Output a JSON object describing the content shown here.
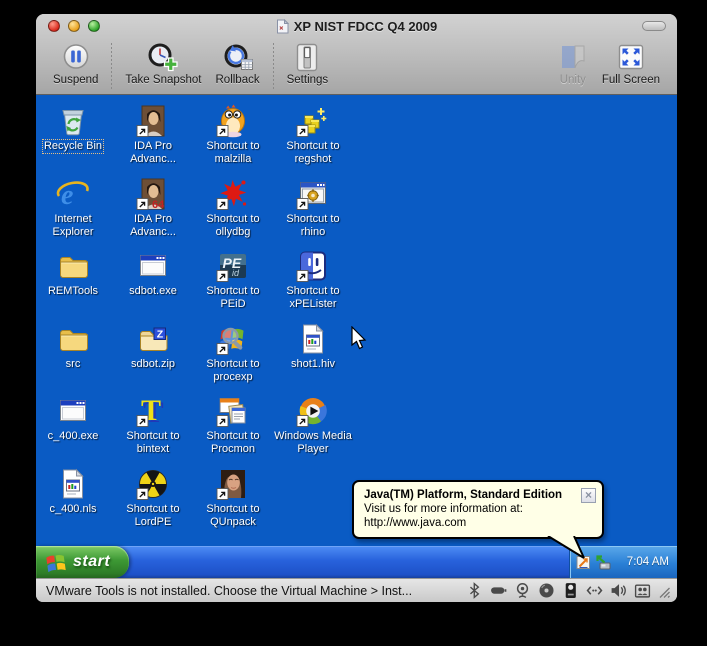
{
  "window": {
    "title": "XP NIST FDCC Q4 2009",
    "title_proxy_icon": "document-icon",
    "traffic_lights": [
      {
        "name": "close-button",
        "color": "#D92A1E"
      },
      {
        "name": "minimize-button",
        "color": "#E8A11E"
      },
      {
        "name": "zoom-button",
        "color": "#2FA42A"
      }
    ],
    "toolbar": {
      "buttons": [
        {
          "label": "Suspend",
          "icon": "suspend-icon",
          "disabled": false
        },
        {
          "label": "Take Snapshot",
          "icon": "snapshot-icon",
          "disabled": false
        },
        {
          "label": "Rollback",
          "icon": "rollback-icon",
          "disabled": false
        },
        {
          "label": "Settings",
          "icon": "settings-icon",
          "disabled": false
        }
      ],
      "right_buttons": [
        {
          "label": "Unity",
          "icon": "unity-icon",
          "disabled": true
        },
        {
          "label": "Full Screen",
          "icon": "fullscreen-icon",
          "disabled": false
        }
      ]
    }
  },
  "desktop": {
    "background_color": "#0A5BC4",
    "icons": [
      {
        "label": "Recycle Bin",
        "icon": "recycle-bin-icon",
        "shortcut": false,
        "selected": true
      },
      {
        "label": "IDA Pro Advanc...",
        "icon": "ida-pro-icon",
        "shortcut": true,
        "selected": false
      },
      {
        "label": "Shortcut to malzilla",
        "icon": "malzilla-icon",
        "shortcut": true,
        "selected": false
      },
      {
        "label": "Shortcut to regshot",
        "icon": "regshot-icon",
        "shortcut": true,
        "selected": false
      },
      {
        "label": "Internet Explorer",
        "icon": "internet-explorer-icon",
        "shortcut": false,
        "selected": false
      },
      {
        "label": "IDA Pro Advanc...",
        "icon": "ida-pro-64-icon",
        "shortcut": true,
        "selected": false
      },
      {
        "label": "Shortcut to ollydbg",
        "icon": "ollydbg-icon",
        "shortcut": true,
        "selected": false
      },
      {
        "label": "Shortcut to rhino",
        "icon": "rhino-icon",
        "shortcut": true,
        "selected": false
      },
      {
        "label": "REMTools",
        "icon": "folder-icon",
        "shortcut": false,
        "selected": false
      },
      {
        "label": "sdbot.exe",
        "icon": "app-window-icon",
        "shortcut": false,
        "selected": false
      },
      {
        "label": "Shortcut to PEiD",
        "icon": "peid-icon",
        "shortcut": true,
        "selected": false
      },
      {
        "label": "Shortcut to xPELister",
        "icon": "xpelister-icon",
        "shortcut": true,
        "selected": false
      },
      {
        "label": "src",
        "icon": "folder-icon",
        "shortcut": false,
        "selected": false
      },
      {
        "label": "sdbot.zip",
        "icon": "zip-folder-icon",
        "shortcut": false,
        "selected": false
      },
      {
        "label": "Shortcut to procexp",
        "icon": "procexp-icon",
        "shortcut": true,
        "selected": false
      },
      {
        "label": "shot1.hiv",
        "icon": "hiv-doc-icon",
        "shortcut": false,
        "selected": false
      },
      {
        "label": "c_400.exe",
        "icon": "app-window-icon",
        "shortcut": false,
        "selected": false
      },
      {
        "label": "Shortcut to bintext",
        "icon": "bintext-icon",
        "shortcut": true,
        "selected": false
      },
      {
        "label": "Shortcut to Procmon",
        "icon": "procmon-icon",
        "shortcut": true,
        "selected": false
      },
      {
        "label": "Windows Media Player",
        "icon": "wmplayer-icon",
        "shortcut": true,
        "selected": false
      },
      {
        "label": "c_400.nls",
        "icon": "hiv-doc-icon",
        "shortcut": false,
        "selected": false
      },
      {
        "label": "Shortcut to LordPE",
        "icon": "lordpe-icon",
        "shortcut": true,
        "selected": false
      },
      {
        "label": "Shortcut to QUnpack",
        "icon": "qunpack-icon",
        "shortcut": true,
        "selected": false
      }
    ]
  },
  "balloon": {
    "title": "Java(TM) Platform, Standard Edition",
    "line1": "Visit us for more information at:",
    "line2": "http://www.java.com",
    "close_icon": "close-icon",
    "background_color": "#FFFFE7"
  },
  "taskbar": {
    "start_label": "start",
    "start_icon": "windows-flag-icon",
    "clock": "7:04 AM",
    "tray_icons": [
      "java-update-icon",
      "safely-remove-hardware-icon"
    ],
    "accent_color": "#2862DC",
    "start_color": "#3D9834"
  },
  "statusbar": {
    "message": "VMware Tools is not installed. Choose the Virtual Machine > Inst...",
    "icons": [
      "bluetooth-icon",
      "battery-icon",
      "webcam-icon",
      "cd-icon",
      "harddisk-icon",
      "network-icon",
      "volume-icon",
      "shared-folder-icon"
    ],
    "grip_icon": "resize-grip-icon"
  },
  "cursor": {
    "icon": "arrow-cursor-icon"
  }
}
